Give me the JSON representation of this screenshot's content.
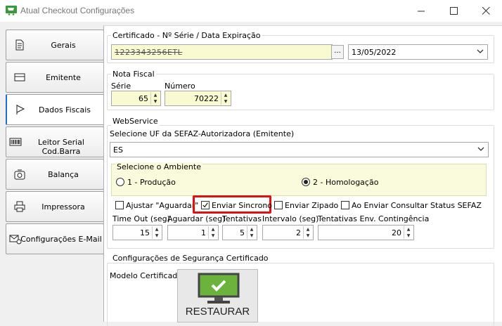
{
  "window": {
    "title": "Atual Checkout Configurações"
  },
  "sidebar": {
    "items": [
      {
        "label": "Gerais",
        "icon": "document-icon"
      },
      {
        "label": "Emitente",
        "icon": "card-icon"
      },
      {
        "label": "Dados Fiscais",
        "icon": "flag-icon"
      },
      {
        "label": "Leitor Serial Cod.Barra",
        "icon": "barcode-icon"
      },
      {
        "label": "Balança",
        "icon": "scale-icon"
      },
      {
        "label": "Impressora",
        "icon": "printer-icon"
      },
      {
        "label": "Configurações E-Mail",
        "icon": "email-gear-icon"
      }
    ],
    "active_index": 2
  },
  "certificado": {
    "group_title": "Certificado - Nº Série / Data Expiração",
    "serial_value": "1223343256ETL",
    "browse_label": "...",
    "date_value": "13/05/2022"
  },
  "nota_fiscal": {
    "group_title": "Nota Fiscal",
    "serie_label": "Série",
    "serie_value": "65",
    "numero_label": "Número",
    "numero_value": "70222"
  },
  "webservice": {
    "group_title": "WebService",
    "uf_label": "Selecione UF da SEFAZ-Autorizadora (Emitente)",
    "uf_value": "ES",
    "ambiente_title": "Selecione o Ambiente",
    "ambiente_producao": "1 - Produção",
    "ambiente_homologacao": "2 - Homologação",
    "ambiente_selected": "2 - Homologação",
    "check_ajustar": "Ajustar \"Aguardar\"",
    "check_ajustar_checked": false,
    "check_sincrono": "Enviar Sincrono",
    "check_sincrono_checked": true,
    "check_zipado": "Enviar Zipado",
    "check_zipado_checked": false,
    "check_consultar": "Ao Enviar Consultar Status SEFAZ",
    "check_consultar_checked": false,
    "timeout_label": "Time Out (seg)",
    "timeout_value": "15",
    "aguardar_label": "Aguardar (seg)",
    "aguardar_value": "1",
    "tentativas_label": "Tentativas",
    "tentativas_value": "5",
    "intervalo_label": "Intervalo (seg)",
    "intervalo_value": "2",
    "contingencia_label": "Tentativas Env. Contingência",
    "contingencia_value": "20"
  },
  "seguranca": {
    "group_title": "Configurações de Segurança Certificado",
    "modelo_label": "Modelo Certificado",
    "restore_label": "RESTAURAR"
  },
  "colors": {
    "highlight": "#e01010",
    "field_yellow": "#fafad2",
    "monitor_green": "#6cb33e"
  }
}
